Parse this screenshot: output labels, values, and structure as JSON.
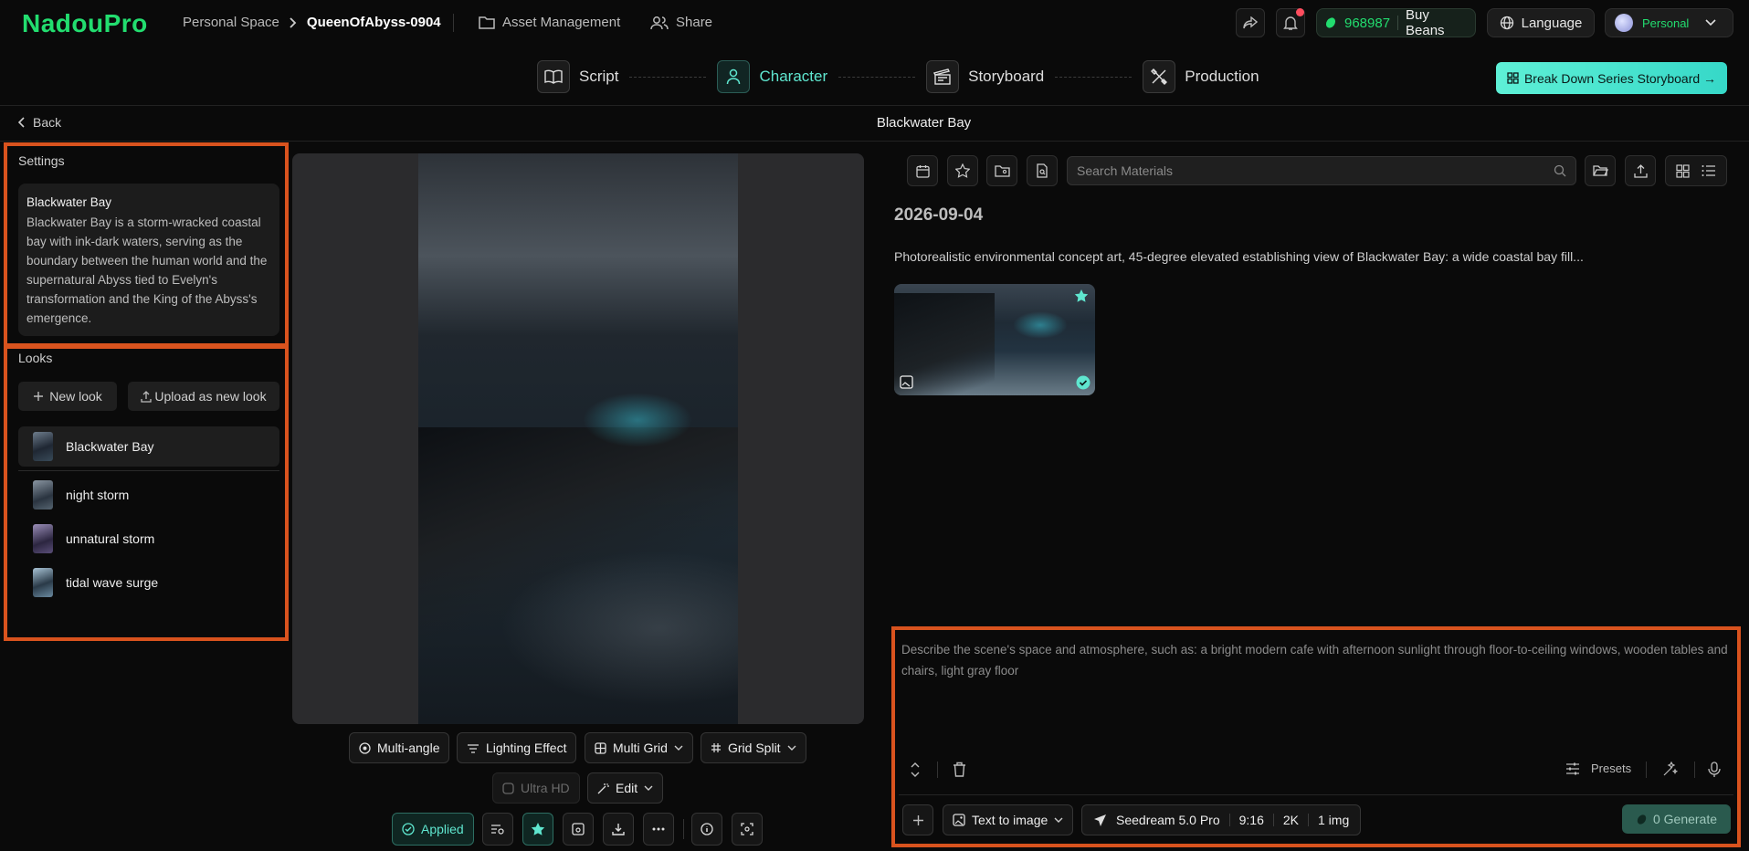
{
  "app": {
    "logo": "NadouPro"
  },
  "breadcrumb": {
    "space": "Personal Space",
    "project": "QueenOfAbyss-0904"
  },
  "topnav": {
    "asset": "Asset Management",
    "share": "Share",
    "beans": "968987",
    "buy": "Buy Beans",
    "language": "Language",
    "account": "Personal"
  },
  "steps": [
    {
      "label": "Script"
    },
    {
      "label": "Character"
    },
    {
      "label": "Storyboard"
    },
    {
      "label": "Production"
    }
  ],
  "cta": {
    "label": "Break Down Series Storyboard →"
  },
  "page": {
    "back": "Back",
    "title": "Blackwater Bay"
  },
  "settings": {
    "title": "Settings",
    "name": "Blackwater Bay",
    "description": "Blackwater Bay is a storm-wracked coastal bay with ink-dark waters, serving as the boundary between the human world and the supernatural Abyss tied to Evelyn's transformation and the King of the Abyss's emergence."
  },
  "looks": {
    "title": "Looks",
    "new_look": "New look",
    "upload": "Upload as new look",
    "items": [
      {
        "label": "Blackwater Bay",
        "selected": true
      },
      {
        "label": "night storm",
        "selected": false
      },
      {
        "label": "unnatural storm",
        "selected": false
      },
      {
        "label": "tidal wave surge",
        "selected": false
      }
    ]
  },
  "image_tools": {
    "multi_angle": "Multi-angle",
    "lighting": "Lighting Effect",
    "multi_grid": "Multi Grid",
    "grid_split": "Grid Split",
    "ultra_hd": "Ultra HD",
    "edit": "Edit",
    "applied": "Applied"
  },
  "materials": {
    "search_placeholder": "Search Materials",
    "date": "2026-09-04",
    "prompt_preview": "Photorealistic environmental concept art, 45-degree elevated establishing view of Blackwater Bay: a wide coastal bay fill..."
  },
  "composer": {
    "placeholder": "Describe the scene's space and atmosphere, such as: a bright modern cafe with afternoon sunlight through floor-to-ceiling windows, wooden tables and chairs, light gray floor",
    "presets": "Presets",
    "mode": "Text to image",
    "model": "Seedream 5.0 Pro",
    "ratio": "9:16",
    "resolution": "2K",
    "count": "1 img",
    "generate": "0 Generate"
  },
  "colors": {
    "brand": "#22dd6f",
    "accent": "#5fe6cf",
    "highlight": "#d9531e"
  }
}
